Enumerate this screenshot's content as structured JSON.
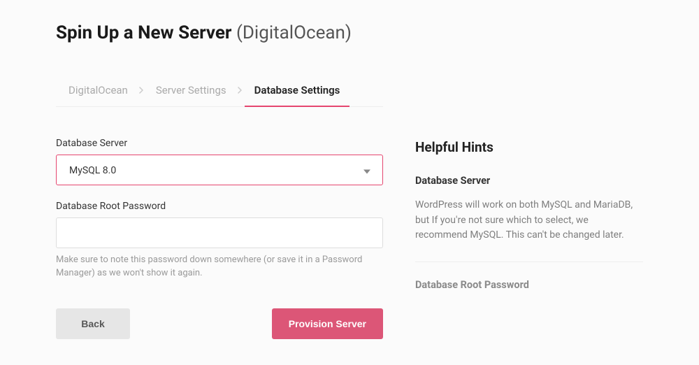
{
  "header": {
    "title_main": "Spin Up a New Server",
    "title_provider": "(DigitalOcean)"
  },
  "tabs": [
    {
      "label": "DigitalOcean",
      "active": false
    },
    {
      "label": "Server Settings",
      "active": false
    },
    {
      "label": "Database Settings",
      "active": true
    }
  ],
  "form": {
    "db_server": {
      "label": "Database Server",
      "value": "MySQL 8.0"
    },
    "db_root_password": {
      "label": "Database Root Password",
      "value": "",
      "helper": "Make sure to note this password down somewhere (or save it in a Password Manager) as we won't show it again."
    }
  },
  "buttons": {
    "back": "Back",
    "provision": "Provision Server"
  },
  "hints": {
    "title": "Helpful Hints",
    "db_server": {
      "heading": "Database Server",
      "body": "WordPress will work on both MySQL and MariaDB, but If you're not sure which to select, we recommend MySQL. This can't be changed later."
    },
    "db_root_password": {
      "heading": "Database Root Password"
    }
  }
}
